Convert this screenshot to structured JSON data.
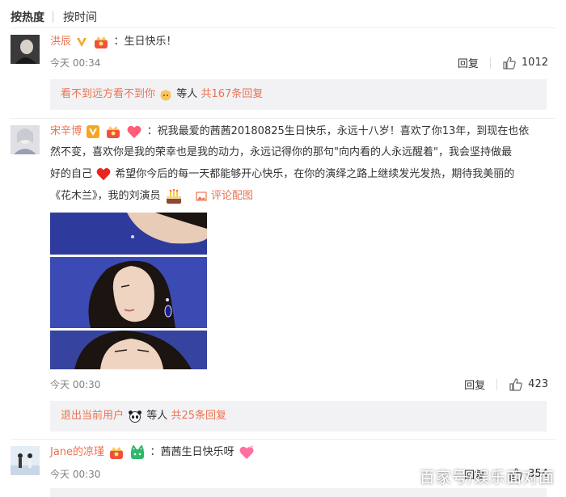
{
  "sort": {
    "hot": "按热度",
    "time": "按时间"
  },
  "comments": [
    {
      "user": "洪辰",
      "separator": "：",
      "text": "生日快乐！",
      "time": "今天 00:34",
      "reply_label": "回复",
      "likes": "1012",
      "replies": {
        "user": "看不到远方看不到你",
        "mid": "等人",
        "count": "共167条回复"
      }
    },
    {
      "user": "宋辛博",
      "separator": "：",
      "lines": [
        "祝我最爱的茜茜20180825生日快乐，永远十八岁！喜欢了你13年，到现在也依",
        "然不变，喜欢你是我的荣幸也是我的动力，永远记得你的那句\"向内看的人永远醒着\"，我会坚持做最",
        "好的自己",
        "希望你今后的每一天都能够开心快乐，在你的演绎之路上继续发光发热，期待我美丽的",
        "《花木兰》，我的刘演员"
      ],
      "pic_link": "评论配图",
      "time": "今天 00:30",
      "reply_label": "回复",
      "likes": "423",
      "replies": {
        "user": "退出当前用户",
        "mid": "等人",
        "count": "共25条回复"
      }
    },
    {
      "user": "Jane的凉瑾",
      "separator": "：",
      "text": "茜茜生日快乐呀",
      "time": "今天 00:30",
      "reply_label": "回复",
      "likes": "354"
    }
  ],
  "watermark": "百家号/娱乐面对面",
  "colors": {
    "name": "#eb7350",
    "link": "#eb7350",
    "reply_bg": "#f2f2f5",
    "time": "#808080"
  },
  "icons": [
    "vip-v-icon",
    "crown-badge-icon",
    "heart-badge-icon",
    "thumb-up-icon",
    "cake-icon",
    "image-icon",
    "panda-icon",
    "cat-emoji-icon"
  ]
}
